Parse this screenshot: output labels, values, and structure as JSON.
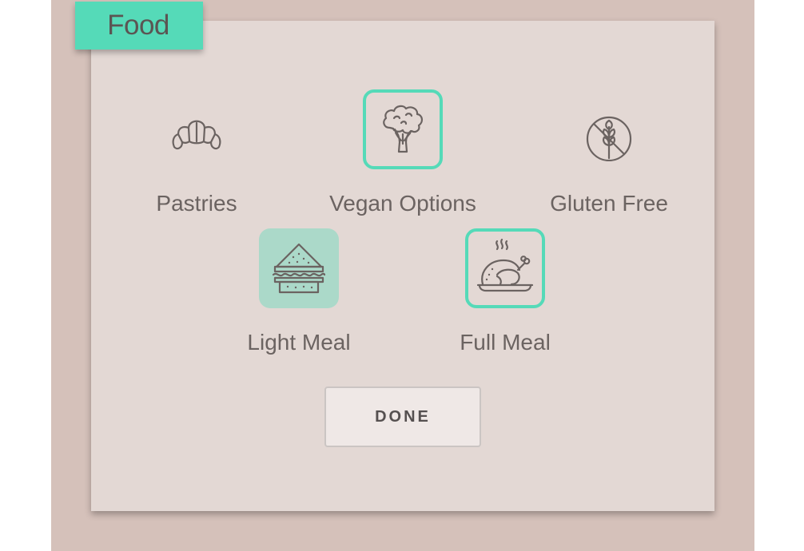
{
  "panel": {
    "title": "Food"
  },
  "options": [
    {
      "id": "pastries",
      "label": "Pastries",
      "icon": "croissant-icon",
      "state": "unselected"
    },
    {
      "id": "vegan",
      "label": "Vegan Options",
      "icon": "broccoli-icon",
      "state": "selected"
    },
    {
      "id": "gluten-free",
      "label": "Gluten Free",
      "icon": "no-wheat-icon",
      "state": "unselected"
    },
    {
      "id": "light-meal",
      "label": "Light Meal",
      "icon": "sandwich-icon",
      "state": "highlighted"
    },
    {
      "id": "full-meal",
      "label": "Full Meal",
      "icon": "roast-chicken-icon",
      "state": "selected"
    }
  ],
  "actions": {
    "done_label": "DONE"
  },
  "colors": {
    "accent": "#55dab8",
    "highlight_fill": "#abd9c9",
    "card_background": "#e3d8d4",
    "outer_background": "#d5c1ba",
    "text": "#6b6361"
  }
}
